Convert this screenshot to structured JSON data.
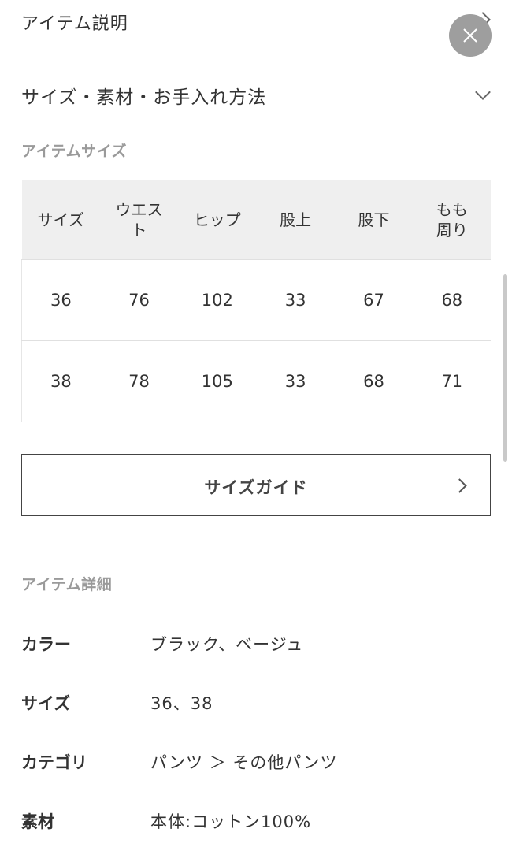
{
  "top": {
    "title": "アイテム説明"
  },
  "accordion": {
    "title": "サイズ・素材・お手入れ方法"
  },
  "size_section": {
    "label": "アイテムサイズ",
    "headers": [
      "サイズ",
      "ウエスト",
      "ヒップ",
      "股上",
      "股下",
      "もも周り"
    ],
    "rows": [
      [
        "36",
        "76",
        "102",
        "33",
        "67",
        "68"
      ],
      [
        "38",
        "78",
        "105",
        "33",
        "68",
        "71"
      ]
    ]
  },
  "size_guide": {
    "label": "サイズガイド"
  },
  "details": {
    "label": "アイテム詳細",
    "items": [
      {
        "key": "カラー",
        "value": "ブラック、ベージュ"
      },
      {
        "key": "サイズ",
        "value": "36、38"
      },
      {
        "key": "カテゴリ",
        "value": "パンツ ＞ その他パンツ"
      },
      {
        "key": "素材",
        "value": "本体:コットン100%"
      }
    ]
  },
  "icons": {
    "close": "close-icon",
    "chevron_right": "chevron-right-icon",
    "chevron_down": "chevron-down-icon"
  },
  "colors": {
    "close_button_bg": "#9e9e9e",
    "table_header_bg": "#efefef",
    "section_label": "#9a9a9a"
  }
}
